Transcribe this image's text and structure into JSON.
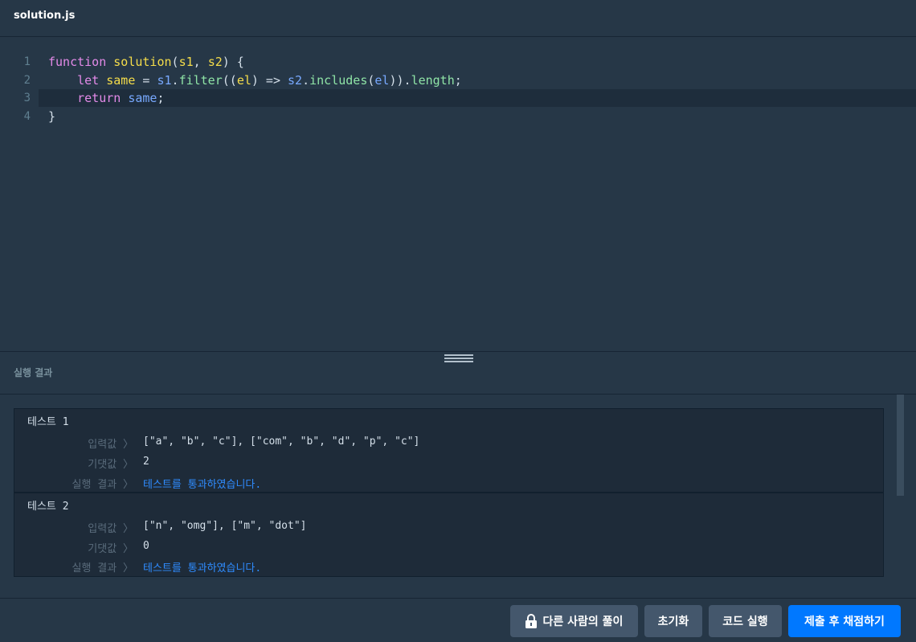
{
  "file_tab": {
    "title": "solution.js"
  },
  "editor": {
    "lines": [
      {
        "number": "1",
        "text": "function solution(s1, s2) {"
      },
      {
        "number": "2",
        "text": "    let same = s1.filter((el) => s2.includes(el)).length;"
      },
      {
        "number": "3",
        "text": "    return same;"
      },
      {
        "number": "4",
        "text": "}"
      }
    ],
    "active_line": 3
  },
  "results_panel": {
    "title": "실행 결과",
    "labels": {
      "input": "입력값 〉",
      "expected": "기댓값 〉",
      "result": "실행 결과 〉"
    },
    "tests": [
      {
        "title": "테스트 1",
        "input": "[\"a\", \"b\", \"c\"], [\"com\", \"b\", \"d\", \"p\", \"c\"]",
        "expected": "2",
        "result": "테스트를 통과하였습니다."
      },
      {
        "title": "테스트 2",
        "input": "[\"n\", \"omg\"], [\"m\", \"dot\"]",
        "expected": "0",
        "result": "테스트를 통과하였습니다."
      }
    ]
  },
  "footer": {
    "other_solutions_label": "다른 사람의 풀이",
    "reset_label": "초기화",
    "run_label": "코드 실행",
    "submit_label": "제출 후 채점하기"
  },
  "colors": {
    "background": "#263747",
    "accent": "#0078ff",
    "pass": "#2f8cff"
  },
  "icons": {
    "other_solutions": "lock-icon",
    "resize": "drag-handle-icon"
  }
}
